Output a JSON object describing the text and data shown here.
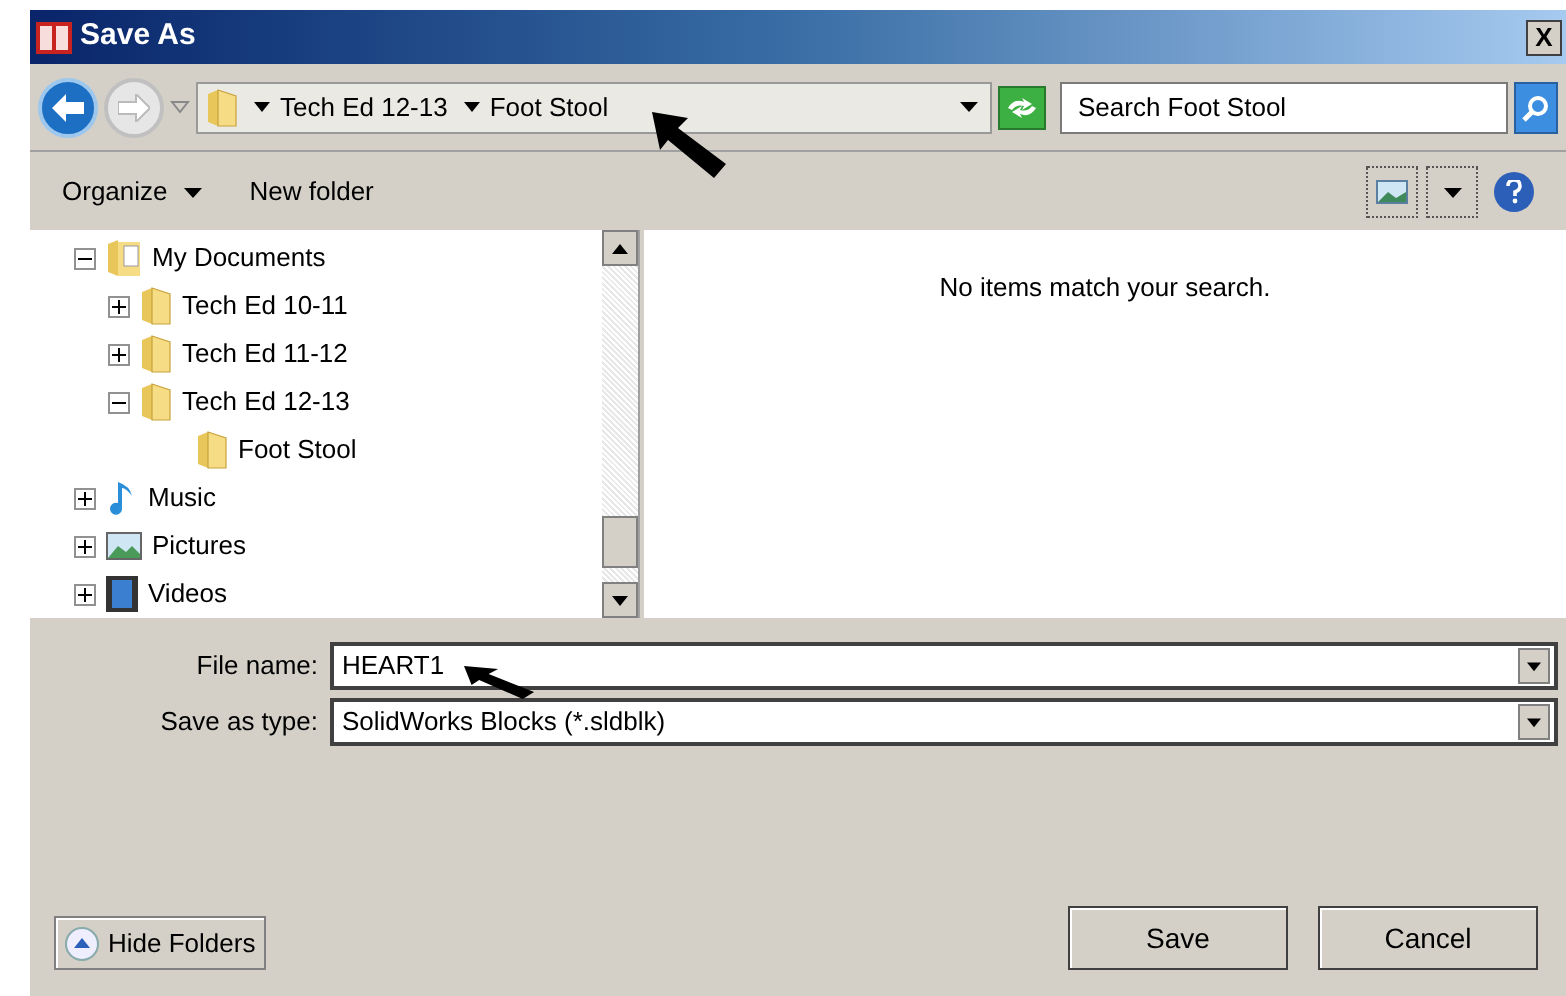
{
  "window": {
    "title": "Save As",
    "close": "X"
  },
  "address": {
    "crumbs": [
      "Tech Ed 12-13",
      "Foot Stool"
    ],
    "search_placeholder": "Search Foot Stool"
  },
  "toolbar": {
    "organize": "Organize",
    "new_folder": "New folder"
  },
  "tree": [
    {
      "label": "My Documents",
      "kind": "documents",
      "expanded": true,
      "children": [
        {
          "label": "Tech Ed 10-11",
          "kind": "folder",
          "expanded": false
        },
        {
          "label": "Tech Ed 11-12",
          "kind": "folder",
          "expanded": false
        },
        {
          "label": "Tech Ed 12-13",
          "kind": "folder",
          "expanded": true,
          "children": [
            {
              "label": "Foot Stool",
              "kind": "leaf"
            }
          ]
        }
      ]
    },
    {
      "label": "Music",
      "kind": "music",
      "expanded": false
    },
    {
      "label": "Pictures",
      "kind": "pictures",
      "expanded": false
    },
    {
      "label": "Videos",
      "kind": "videos",
      "expanded": false
    }
  ],
  "content": {
    "message": "No items match your search."
  },
  "form": [
    {
      "label": "File name:",
      "value": "HEART1"
    },
    {
      "label": "Save as type:",
      "value": "SolidWorks Blocks (*.sldblk)"
    }
  ],
  "buttons": {
    "hide_folders": "Hide Folders",
    "save": "Save",
    "cancel": "Cancel"
  }
}
